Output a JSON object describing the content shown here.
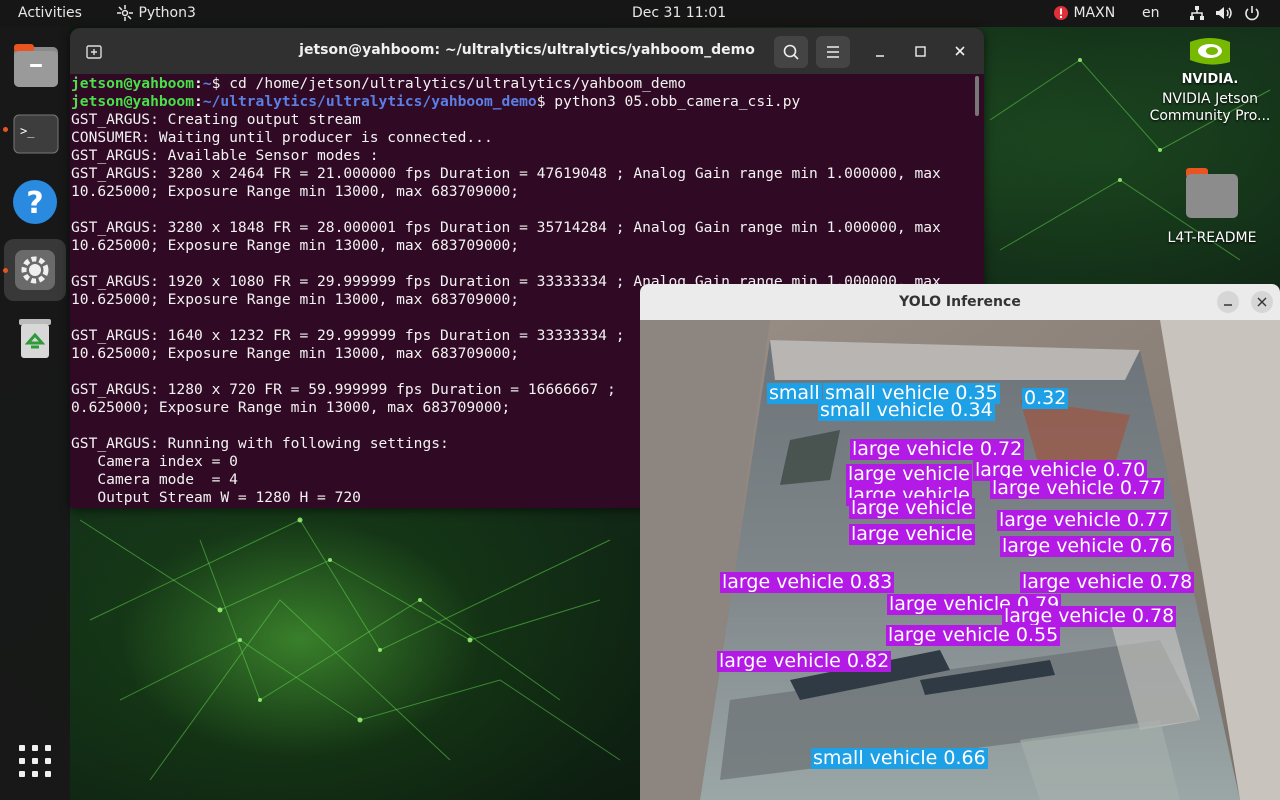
{
  "topbar": {
    "activities": "Activities",
    "app_name": "Python3",
    "clock": "Dec 31  11:01",
    "power_mode": "MAXN",
    "input_source": "en"
  },
  "dock": {
    "items": [
      {
        "name": "files",
        "icon": "folder-icon"
      },
      {
        "name": "terminal",
        "icon": "terminal-icon"
      },
      {
        "name": "help",
        "icon": "help-icon"
      },
      {
        "name": "settings",
        "icon": "gear-icon"
      },
      {
        "name": "trash",
        "icon": "trash-icon"
      }
    ],
    "apps_grid_icon": "grid-icon"
  },
  "desktop": {
    "nvidia_label": "NVIDIA Jetson Community Pro...",
    "nvidia_logo_text": "NVIDIA.",
    "readme_label": "L4T-README"
  },
  "terminal": {
    "title": "jetson@yahboom: ~/ultralytics/ultralytics/yahboom_demo",
    "prompt_user": "jetson@yahboom",
    "prompt_path_1": "~",
    "cmd_1": "cd /home/jetson/ultralytics/ultralytics/yahboom_demo",
    "prompt_path_2": "~/ultralytics/ultralytics/yahboom_demo",
    "cmd_2": "python3 05.obb_camera_csi.py",
    "lines": [
      "GST_ARGUS: Creating output stream",
      "CONSUMER: Waiting until producer is connected...",
      "GST_ARGUS: Available Sensor modes :",
      "GST_ARGUS: 3280 x 2464 FR = 21.000000 fps Duration = 47619048 ; Analog Gain range min 1.000000, max",
      "10.625000; Exposure Range min 13000, max 683709000;",
      "",
      "GST_ARGUS: 3280 x 1848 FR = 28.000001 fps Duration = 35714284 ; Analog Gain range min 1.000000, max",
      "10.625000; Exposure Range min 13000, max 683709000;",
      "",
      "GST_ARGUS: 1920 x 1080 FR = 29.999999 fps Duration = 33333334 ; Analog Gain range min 1.000000, max",
      "10.625000; Exposure Range min 13000, max 683709000;",
      "",
      "GST_ARGUS: 1640 x 1232 FR = 29.999999 fps Duration = 33333334 ;",
      "10.625000; Exposure Range min 13000, max 683709000;",
      "",
      "GST_ARGUS: 1280 x 720 FR = 59.999999 fps Duration = 16666667 ;",
      "0.625000; Exposure Range min 13000, max 683709000;",
      "",
      "GST_ARGUS: Running with following settings:",
      "   Camera index = 0",
      "   Camera mode  = 4",
      "   Output Stream W = 1280 H = 720"
    ]
  },
  "yolo": {
    "title": "YOLO Inference",
    "detections": [
      {
        "cls": "small",
        "text": "small"
      },
      {
        "cls": "small",
        "text": "small vehicle 0.35"
      },
      {
        "cls": "small",
        "text": "0.32"
      },
      {
        "cls": "small",
        "text": "small vehicle 0.34"
      },
      {
        "cls": "large",
        "text": "large vehicle 0.72"
      },
      {
        "cls": "large",
        "text": "large vehicle"
      },
      {
        "cls": "large",
        "text": "large vehicle 0.70"
      },
      {
        "cls": "large",
        "text": "large vehicle"
      },
      {
        "cls": "large",
        "text": "large vehicle 0.77"
      },
      {
        "cls": "large",
        "text": "large vehicle"
      },
      {
        "cls": "large",
        "text": "large vehicle 0.77"
      },
      {
        "cls": "large",
        "text": "large vehicle"
      },
      {
        "cls": "large",
        "text": "large vehicle 0.76"
      },
      {
        "cls": "large",
        "text": "large vehicle 0.83"
      },
      {
        "cls": "large",
        "text": "large vehicle 0.78"
      },
      {
        "cls": "large",
        "text": "large vehicle 0.79"
      },
      {
        "cls": "large",
        "text": "large vehicle 0.78"
      },
      {
        "cls": "large",
        "text": "large vehicle 0.55"
      },
      {
        "cls": "large",
        "text": "large vehicle 0.82"
      },
      {
        "cls": "small",
        "text": "small vehicle 0.66"
      }
    ]
  },
  "colors": {
    "terminal_bg": "#300a24",
    "large_vehicle": "#b31ae6",
    "small_vehicle": "#1ea0e6",
    "accent": "#e95420"
  }
}
